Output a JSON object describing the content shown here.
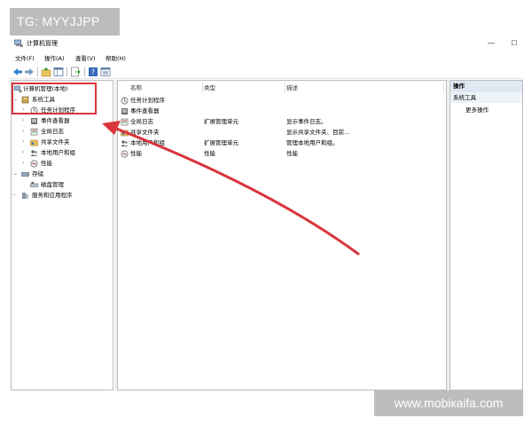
{
  "watermarks": {
    "top_left": "TG: MYYJJPP",
    "bottom_right": "www.mobiкaifa.com"
  },
  "window": {
    "title": "计算机管理",
    "minimize_glyph": "—",
    "maximize_glyph": "☐"
  },
  "menu": {
    "items": [
      "文件(F)",
      "操作(A)",
      "查看(V)",
      "帮助(H)"
    ]
  },
  "toolbar": {
    "buttons": [
      "back-icon",
      "forward-icon",
      "up-folder-icon",
      "show-hide-tree-icon",
      "export-icon",
      "help-icon",
      "properties-icon"
    ]
  },
  "tree": {
    "root": "计算机管理(本地)",
    "system_tools": "系统工具",
    "task_scheduler": "任务计划程序",
    "event_viewer": "事件查看器",
    "shared_folders": "共享文件夹",
    "global_log": "全局日志",
    "local_users": "本地用户和组",
    "performance": "性能",
    "storage": "存储",
    "disk_management": "磁盘管理",
    "services_apps": "服务和应用程序"
  },
  "list": {
    "columns": [
      "名称",
      "类型",
      "描述"
    ],
    "rows": [
      {
        "name": "任务计划程序",
        "type": "",
        "desc": ""
      },
      {
        "name": "事件查看器",
        "type": "",
        "desc": ""
      },
      {
        "name": "全局日志",
        "type": "扩展管理单元",
        "desc": "显示事件日志。"
      },
      {
        "name": "共享文件夹",
        "type": "",
        "desc": "显示共享文件夹、目前..."
      },
      {
        "name": "本地用户和组",
        "type": "扩展管理单元",
        "desc": "管理本地用户和组。"
      },
      {
        "name": "性能",
        "type": "性能",
        "desc": "性能"
      }
    ]
  },
  "actions": {
    "header": "操作",
    "section": "系统工具",
    "more": "更多操作"
  },
  "colors": {
    "annotation_red": "#d9353c",
    "watermark_gray": "#bdbdbd",
    "action_header_blue": "#dfe8f3"
  }
}
